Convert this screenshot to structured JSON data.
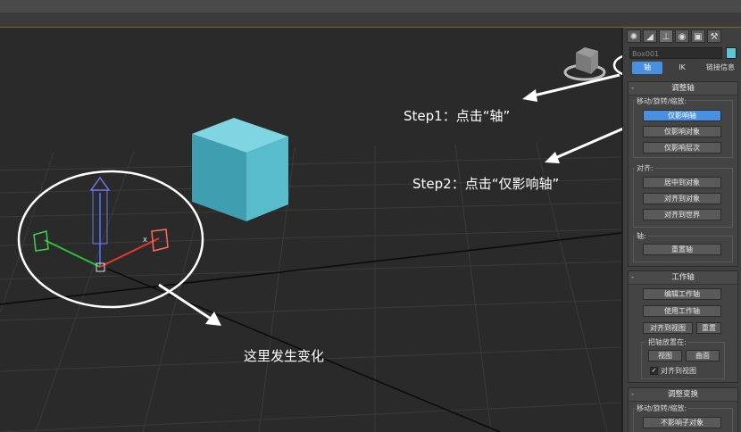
{
  "annotations": {
    "step1": "Step1：点击“轴”",
    "step2": "Step2：点击“仅影响轴”",
    "change_here": "这里发生变化"
  },
  "panel": {
    "tab_icons": [
      "create-icon",
      "modify-icon",
      "hierarchy-icon",
      "motion-icon",
      "display-icon",
      "utilities-icon"
    ],
    "object_name": "Box001",
    "object_color": "#5bc7d6",
    "subtabs": [
      "轴",
      "IK",
      "链接信息"
    ],
    "adjust_pivot": {
      "title": "调整轴",
      "group_label": "移动/旋转/缩放:",
      "buttons": [
        "仅影响轴",
        "仅影响对象",
        "仅影响层次"
      ]
    },
    "align": {
      "group_label": "对齐:",
      "buttons": [
        "居中到对象",
        "对齐到对象",
        "对齐到世界"
      ]
    },
    "pivot": {
      "group_label": "轴:",
      "buttons": [
        "重置轴"
      ]
    },
    "working_pivot": {
      "title": "工作轴",
      "buttons": [
        "编辑工作轴",
        "使用工作轴",
        "对齐到视图",
        "重置"
      ],
      "place_label": "把轴放置在:",
      "place_buttons": [
        "视图",
        "曲面"
      ],
      "checkbox_label": "对齐到视图"
    },
    "adjust_transform": {
      "title": "调整变换",
      "group_label": "移动/旋转/缩放:",
      "buttons": [
        "不影响子对象"
      ]
    }
  },
  "viewport": {
    "gizmo_axis_label": "X",
    "cube_color": "#4fb3c4"
  }
}
